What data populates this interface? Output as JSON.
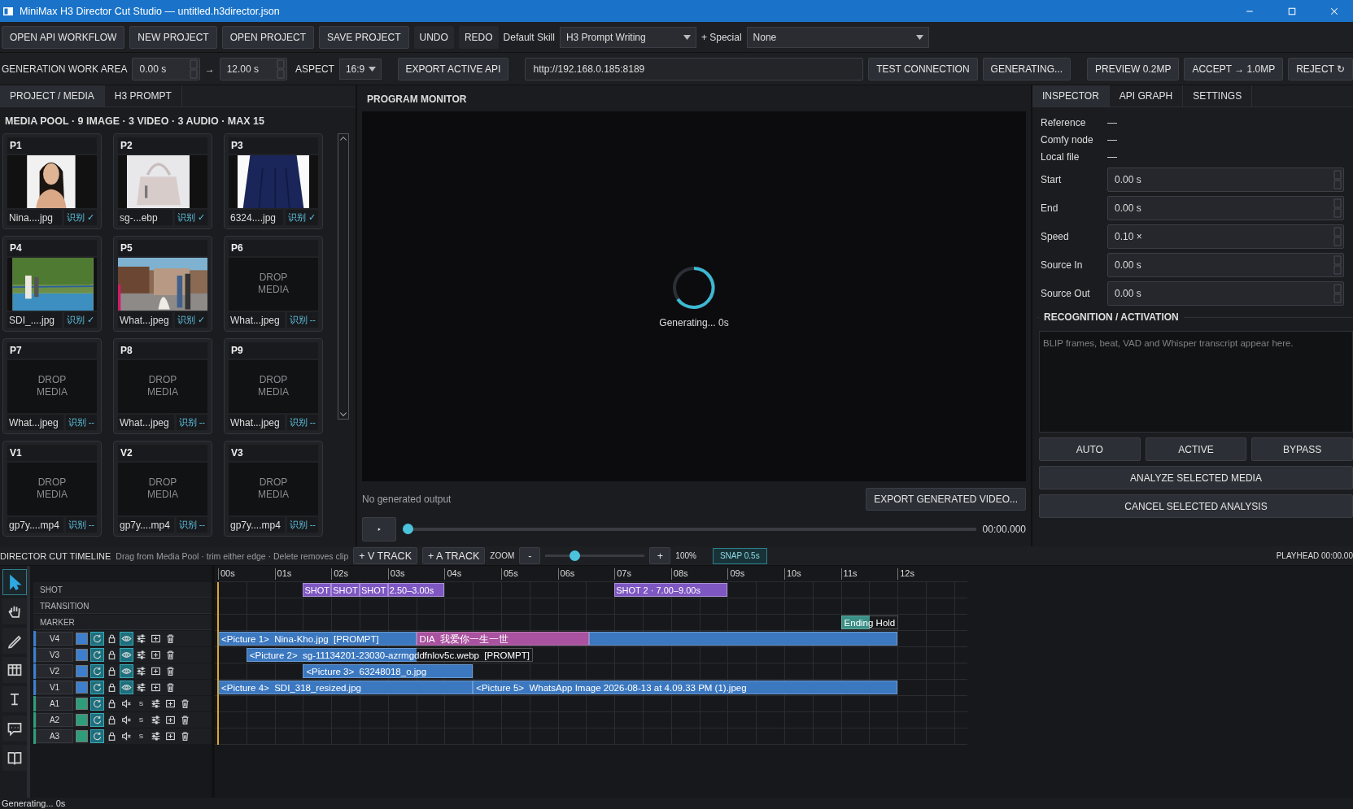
{
  "window": {
    "title": "MiniMax H3 Director Cut Studio — untitled.h3director.json"
  },
  "toolbar": {
    "buttons": [
      {
        "label": "OPEN API WORKFLOW",
        "kind": "raised"
      },
      {
        "label": "NEW PROJECT",
        "kind": "raised"
      },
      {
        "label": "OPEN PROJECT",
        "kind": "raised"
      },
      {
        "label": "SAVE PROJECT",
        "kind": "raised"
      },
      {
        "label": "UNDO",
        "kind": "flat"
      },
      {
        "label": "REDO",
        "kind": "flat"
      }
    ],
    "skill_label": "Default Skill",
    "skill": "H3 Prompt Writing",
    "special_label": "+ Special",
    "special": "None"
  },
  "work_area": {
    "label": "GENERATION WORK AREA",
    "start": "0.00 s",
    "arrow": "→",
    "end": "12.00 s",
    "aspect_label": "ASPECT",
    "aspect": "16:9",
    "export_button": "EXPORT ACTIVE API",
    "url": "http://192.168.0.185:8189",
    "buttons": [
      "TEST CONNECTION",
      "GENERATING...",
      "PREVIEW 0.2MP",
      "ACCEPT → 1.0MP",
      "REJECT ↻"
    ]
  },
  "left_tabs": [
    {
      "label": "PROJECT / MEDIA",
      "selected": true
    },
    {
      "label": "H3 PROMPT",
      "selected": false
    }
  ],
  "media_pool": {
    "title": "MEDIA POOL · 9 IMAGE · 3 VIDEO · 3 AUDIO · MAX 15",
    "slots": [
      {
        "id": "P1",
        "kind": "picture",
        "file": "Nina....jpg",
        "status": "识别 ✓"
      },
      {
        "id": "P2",
        "kind": "picture",
        "file": "sg-...ebp",
        "status": "识别 ✓"
      },
      {
        "id": "P3",
        "kind": "picture",
        "file": "6324....jpg",
        "status": "识别 ✓"
      },
      {
        "id": "P4",
        "kind": "picture",
        "file": "SDI_....jpg",
        "status": "识别 ✓"
      },
      {
        "id": "P5",
        "kind": "picture",
        "file": "What...jpeg",
        "status": "识别 ✓"
      },
      {
        "id": "P6",
        "kind": "empty",
        "placeholder": "DROP MEDIA",
        "file": "What...jpeg",
        "status": "识别 --"
      },
      {
        "id": "P7",
        "kind": "empty",
        "placeholder": "DROP MEDIA",
        "file": "What...jpeg",
        "status": "识别 --"
      },
      {
        "id": "P8",
        "kind": "empty",
        "placeholder": "DROP MEDIA",
        "file": "What...jpeg",
        "status": "识别 --"
      },
      {
        "id": "P9",
        "kind": "empty",
        "placeholder": "DROP MEDIA",
        "file": "What...jpeg",
        "status": "识别 --"
      },
      {
        "id": "V1",
        "kind": "empty",
        "placeholder": "DROP MEDIA",
        "file": "gp7y....mp4",
        "status": "识别 --"
      },
      {
        "id": "V2",
        "kind": "empty",
        "placeholder": "DROP MEDIA",
        "file": "gp7y....mp4",
        "status": "识别 --"
      },
      {
        "id": "V3",
        "kind": "empty",
        "placeholder": "DROP MEDIA",
        "file": "gp7y....mp4",
        "status": "识别 --"
      }
    ]
  },
  "monitor": {
    "title": "PROGRAM MONITOR",
    "status": "Generating... 0s",
    "output": "No generated output",
    "export_button": "EXPORT GENERATED VIDEO...",
    "scrubber": {
      "level": 0
    },
    "time": "00:00.000"
  },
  "right_tabs": [
    {
      "label": "INSPECTOR",
      "selected": true
    },
    {
      "label": "API GRAPH",
      "selected": false
    },
    {
      "label": "SETTINGS",
      "selected": false
    }
  ],
  "inspector": {
    "info": [
      {
        "label": "Reference",
        "value": "—"
      },
      {
        "label": "Comfy node",
        "value": "—"
      },
      {
        "label": "Local file",
        "value": "—"
      }
    ],
    "fields": [
      {
        "label": "Start",
        "value": "0.00 s"
      },
      {
        "label": "End",
        "value": "0.00 s"
      },
      {
        "label": "Speed",
        "value": "0.10 ×"
      },
      {
        "label": "Source In",
        "value": "0.00 s"
      },
      {
        "label": "Source Out",
        "value": "0.00 s"
      }
    ]
  },
  "recognition": {
    "title": "RECOGNITION / ACTIVATION",
    "placeholder": "BLIP frames, beat, VAD and Whisper transcript appear here.",
    "modes": [
      "AUTO",
      "ACTIVE",
      "BYPASS"
    ],
    "actions": [
      "ANALYZE SELECTED MEDIA",
      "CANCEL SELECTED ANALYSIS"
    ]
  },
  "timeline": {
    "title": "DIRECTOR CUT TIMELINE",
    "hint": "Drag from Media Pool · trim either edge · Delete removes clip",
    "add_buttons": [
      "+ V TRACK",
      "+ A TRACK"
    ],
    "zoom_label": "ZOOM",
    "zoom_out": "-",
    "zoom": {
      "level": 0.27
    },
    "zoom_in": "+",
    "zoom_value": "100%",
    "snap": {
      "label": "SNAP 0.5s",
      "on": true
    },
    "playhead": "PLAYHEAD 00:00.00",
    "tools": [
      {
        "kind": "pointer",
        "selected": true
      },
      {
        "kind": "hand",
        "selected": false
      },
      {
        "kind": "blade",
        "selected": false
      },
      {
        "kind": "grid",
        "selected": false
      },
      {
        "kind": "text",
        "selected": false
      },
      {
        "kind": "comment",
        "selected": false
      },
      {
        "kind": "book",
        "selected": false
      }
    ],
    "ruler": [
      "00s",
      "01s",
      "02s",
      "03s",
      "04s",
      "05s",
      "06s",
      "07s",
      "08s",
      "09s",
      "10s",
      "11s",
      "12s"
    ],
    "lanes": [
      {
        "name": "SHOT",
        "clips": [
          {
            "kind": "shot",
            "label": "SHOT"
          },
          {
            "kind": "shot",
            "label": "SHOT"
          },
          {
            "kind": "shot",
            "label": "SHOT"
          },
          {
            "kind": "shot",
            "label": "2.50–3.00s"
          },
          {
            "kind": "shot",
            "label": "SHOT 2 · 7.00–9.00s"
          }
        ]
      },
      {
        "name": "TRANSITION"
      },
      {
        "name": "MARKER",
        "clips": [
          {
            "kind": "marker",
            "label": "Ending Hold"
          }
        ]
      }
    ],
    "tracks": [
      {
        "name": "V4",
        "kind": "video",
        "color": "#3d7fcf",
        "visible": true,
        "clips": [
          {
            "kind": "picture",
            "label": "<Picture 1>  Nina-Kho.jpg  [PROMPT]"
          },
          {
            "kind": "dialogue",
            "label": "DIA  我爱你一生一世"
          },
          {
            "kind": "picture"
          }
        ]
      },
      {
        "name": "V3",
        "kind": "video",
        "color": "#3d7fcf",
        "visible": true,
        "clips": [
          {
            "kind": "picture",
            "label": "<Picture 2>  sg-11134201-23030-azrmgddfnlov5c.webp  [PROMPT]"
          }
        ]
      },
      {
        "name": "V2",
        "kind": "video",
        "color": "#3d7fcf",
        "visible": true,
        "clips": [
          {
            "kind": "picture",
            "label": "<Picture 3>  63248018_o.jpg"
          }
        ]
      },
      {
        "name": "V1",
        "kind": "video",
        "color": "#3d7fcf",
        "visible": true,
        "clips": [
          {
            "kind": "picture",
            "label": "<Picture 4>  SDI_318_resized.jpg"
          },
          {
            "kind": "picture",
            "label": "<Picture 5>  WhatsApp Image 2026-08-13 at 4.09.33 PM (1).jpeg"
          }
        ]
      },
      {
        "name": "A1",
        "kind": "audio",
        "color": "#2e9e7a",
        "solo_label": "S"
      },
      {
        "name": "A2",
        "kind": "audio",
        "color": "#2e9e7a",
        "solo_label": "S"
      },
      {
        "name": "A3",
        "kind": "audio",
        "color": "#2e9e7a",
        "solo_label": "S"
      }
    ]
  },
  "status_bar": {
    "text": "Generating...  0s"
  }
}
